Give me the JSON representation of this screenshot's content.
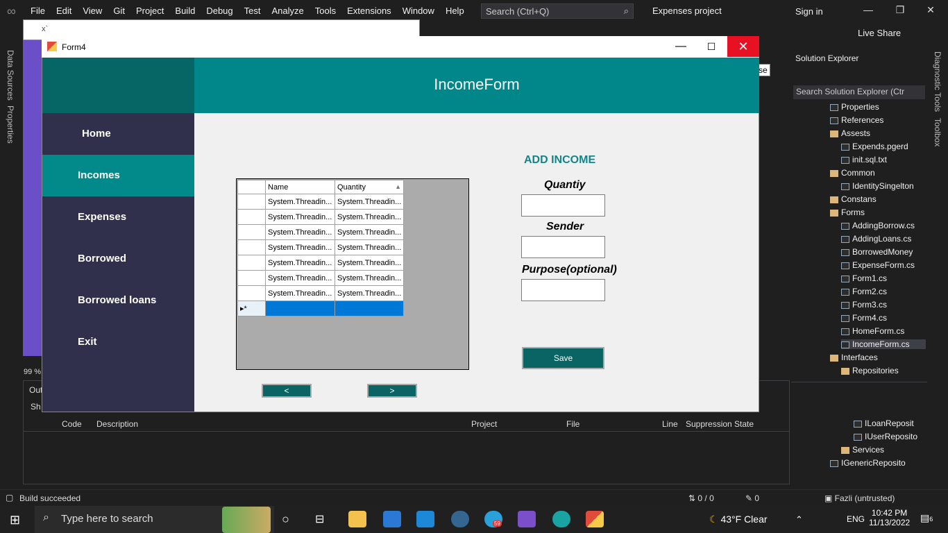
{
  "vs": {
    "menu": [
      "File",
      "Edit",
      "View",
      "Git",
      "Project",
      "Build",
      "Debug",
      "Test",
      "Analyze",
      "Tools",
      "Extensions",
      "Window",
      "Help"
    ],
    "search_placeholder": "Search (Ctrl+Q)",
    "project_name": "Expenses project",
    "sign_in": "Sign in",
    "live_share": "Live Share",
    "zoom": "99 %",
    "status": "Build succeeded",
    "left_tabs": [
      "Data Sources",
      "Properties"
    ],
    "right_tabs": [
      "Diagnostic Tools",
      "Toolbox"
    ],
    "bg_form_title": "x`",
    "error_list": {
      "columns": [
        "Code",
        "Description",
        "Project",
        "File",
        "Line",
        "Suppression State"
      ],
      "side_labels": [
        "Out",
        "Sh"
      ]
    },
    "status_right": {
      "lines": "0 / 0",
      "pencil": "0",
      "user": "Fazli (untrusted)"
    }
  },
  "solution_explorer": {
    "title": "Solution Explorer",
    "search_placeholder": "Search Solution Explorer (Ctr",
    "items": [
      {
        "label": "Properties",
        "type": "prop"
      },
      {
        "label": "References",
        "type": "ref"
      },
      {
        "label": "Assests",
        "type": "folder"
      },
      {
        "label": "Expends.pgerd",
        "type": "file"
      },
      {
        "label": "init.sql.txt",
        "type": "file"
      },
      {
        "label": "Common",
        "type": "folder"
      },
      {
        "label": "IdentitySingelton",
        "type": "cs"
      },
      {
        "label": "Constans",
        "type": "folder"
      },
      {
        "label": "Forms",
        "type": "folder"
      },
      {
        "label": "AddingBorrow.cs",
        "type": "form"
      },
      {
        "label": "AddingLoans.cs",
        "type": "form"
      },
      {
        "label": "BorrowedMoney",
        "type": "form"
      },
      {
        "label": "ExpenseForm.cs",
        "type": "form"
      },
      {
        "label": "Form1.cs",
        "type": "form"
      },
      {
        "label": "Form2.cs",
        "type": "form"
      },
      {
        "label": "Form3.cs",
        "type": "form"
      },
      {
        "label": "Form4.cs",
        "type": "form"
      },
      {
        "label": "HomeForm.cs",
        "type": "form"
      },
      {
        "label": "IncomeForm.cs",
        "type": "form"
      },
      {
        "label": "Interfaces",
        "type": "folder"
      },
      {
        "label": "Repositories",
        "type": "folder"
      }
    ],
    "bottom_items": [
      {
        "label": "ILoanReposit",
        "type": "cs"
      },
      {
        "label": "IUserReposito",
        "type": "cs"
      },
      {
        "label": "Services",
        "type": "folder"
      },
      {
        "label": "IGenericReposito",
        "type": "cs"
      }
    ]
  },
  "form4": {
    "title": "Form4",
    "close_tooltip": "Close",
    "header": "IncomeForm",
    "nav": [
      "Home",
      "Incomes",
      "Expenses",
      "Borrowed",
      "Borrowed loans",
      "Exit"
    ],
    "active_nav": "Incomes",
    "grid": {
      "columns": [
        "Name",
        "Quantity"
      ],
      "rows": [
        [
          "System.Threadin...",
          "System.Threadin..."
        ],
        [
          "System.Threadin...",
          "System.Threadin..."
        ],
        [
          "System.Threadin...",
          "System.Threadin..."
        ],
        [
          "System.Threadin...",
          "System.Threadin..."
        ],
        [
          "System.Threadin...",
          "System.Threadin..."
        ],
        [
          "System.Threadin...",
          "System.Threadin..."
        ],
        [
          "System.Threadin...",
          "System.Threadin..."
        ]
      ],
      "new_row_marker": "▸*"
    },
    "prev_label": "<",
    "next_label": ">",
    "add_income": {
      "title": "ADD INCOME",
      "quantity_label": "Quantiy",
      "sender_label": "Sender",
      "purpose_label": "Purpose(optional)",
      "save_label": "Save"
    }
  },
  "taskbar": {
    "search_placeholder": "Type here to search",
    "weather": "43°F  Clear",
    "lang": "ENG",
    "time": "10:42 PM",
    "date": "11/13/2022",
    "notifications": "6",
    "telegram_badge": "59"
  }
}
